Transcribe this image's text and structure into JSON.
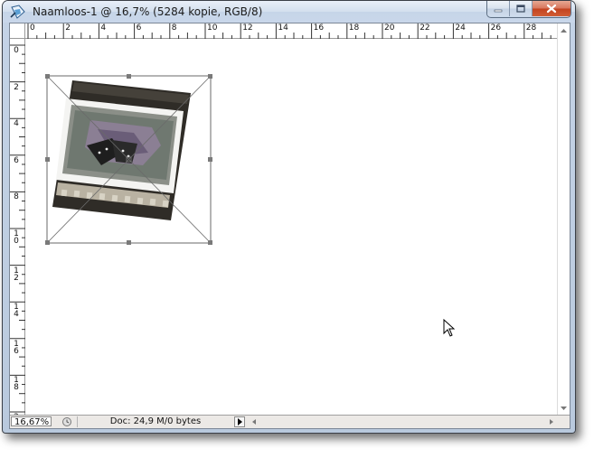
{
  "window": {
    "title": "Naamloos-1 @ 16,7% (5284 kopie, RGB/8)",
    "app_icon": "photoshop-document-icon",
    "buttons": [
      "minimize-icon",
      "maximize-icon",
      "close-icon"
    ]
  },
  "rulers": {
    "top_labels": [
      "0",
      "2",
      "4",
      "6",
      "8",
      "10",
      "12",
      "14",
      "16",
      "18",
      "20",
      "22",
      "24",
      "26",
      "28"
    ],
    "left_labels": [
      "0",
      "2",
      "4",
      "6",
      "8",
      "10",
      "12",
      "14",
      "16",
      "18",
      "20"
    ]
  },
  "status": {
    "zoom": "16,67%",
    "doc_info": "Doc: 24,9 M/0 bytes",
    "menu_arrow_icon": "triangle-right-icon"
  },
  "colors": {
    "title_bar": "#c9d7ea",
    "close_button": "#c2421f",
    "film_frame": "#2f2c27",
    "transform_box": "#6a6a6a"
  }
}
